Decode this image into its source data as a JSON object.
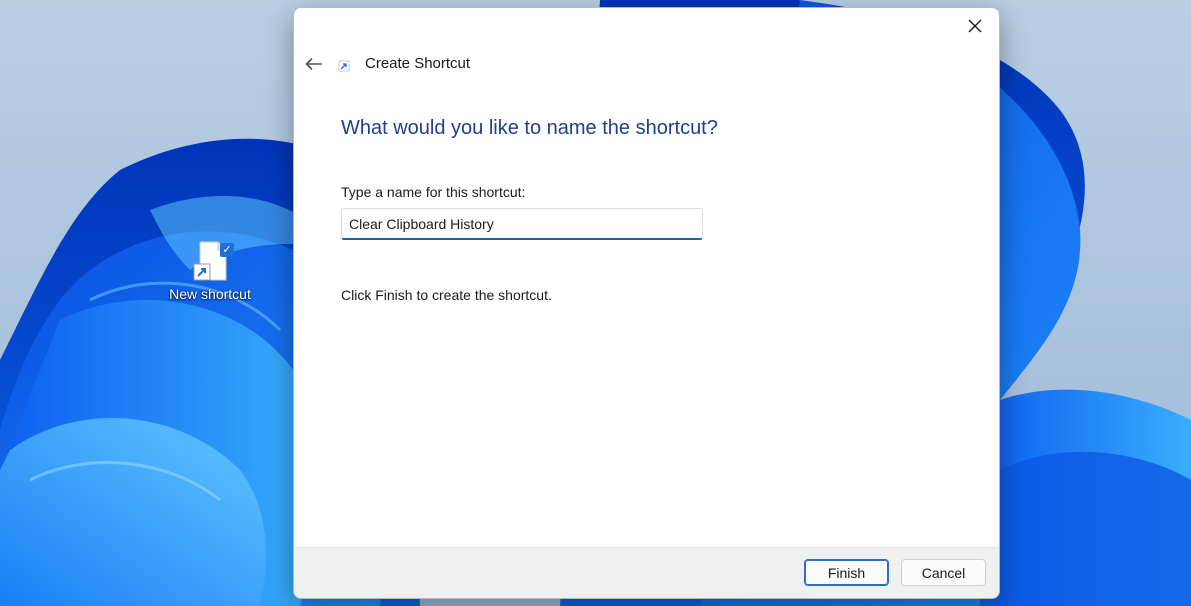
{
  "desktop": {
    "shortcut_label": "New shortcut",
    "icon": "shortcut-file-icon"
  },
  "dialog": {
    "title": "Create Shortcut",
    "heading": "What would you like to name the shortcut?",
    "field_label": "Type a name for this shortcut:",
    "field_value": "Clear Clipboard History",
    "info": "Click Finish to create the shortcut.",
    "buttons": {
      "finish": "Finish",
      "cancel": "Cancel"
    },
    "icons": {
      "close": "close-icon",
      "back": "back-arrow-icon",
      "wizard": "shortcut-arrow-icon"
    }
  },
  "colors": {
    "heading": "#1e3f8a",
    "accent": "#1e5fb4",
    "footer": "#f0f0f0"
  }
}
